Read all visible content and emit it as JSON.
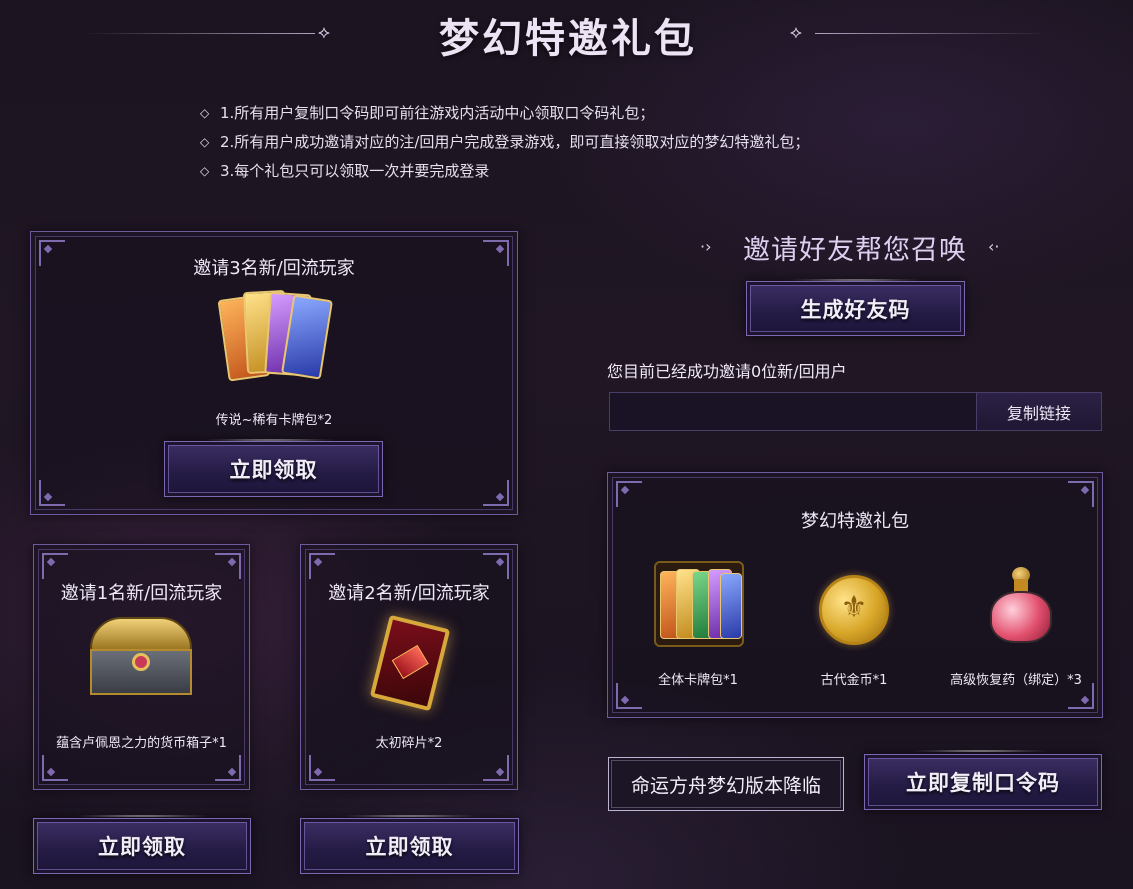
{
  "header": {
    "title": "梦幻特邀礼包",
    "ornament_left": "⟡",
    "ornament_right": "⟡"
  },
  "rules": [
    "1.所有用户复制口令码即可前往游戏内活动中心领取口令码礼包；",
    "2.所有用户成功邀请对应的注/回用户完成登录游戏，即可直接领取对应的梦幻特邀礼包；",
    "3.每个礼包只可以领取一次并要完成登录"
  ],
  "rule_marker": "◇",
  "rewards": {
    "tier3": {
      "title": "邀请3名新/回流玩家",
      "item": "传说~稀有卡牌包*2",
      "button": "立即领取"
    },
    "tier1": {
      "title": "邀请1名新/回流玩家",
      "item": "蕴含卢佩恩之力的货币箱子*1",
      "button": "立即领取"
    },
    "tier2": {
      "title": "邀请2名新/回流玩家",
      "item": "太初碎片*2",
      "button": "立即领取"
    }
  },
  "invite": {
    "heading": "邀请好友帮您召唤",
    "generate_button": "生成好友码",
    "status": "您目前已经成功邀请0位新/回用户",
    "link_value": "",
    "copy_link_button": "复制链接"
  },
  "gift": {
    "title": "梦幻特邀礼包",
    "items": [
      "全体卡牌包*1",
      "古代金币*1",
      "高级恢复药（绑定）*3"
    ],
    "coin_glyph": "⚜"
  },
  "footer": {
    "version_button": "命运方舟梦幻版本降临",
    "copy_code_button": "立即复制口令码"
  },
  "colors": {
    "accent": "#7d67b3",
    "background": "#1e1522",
    "text": "#efe8f7"
  }
}
